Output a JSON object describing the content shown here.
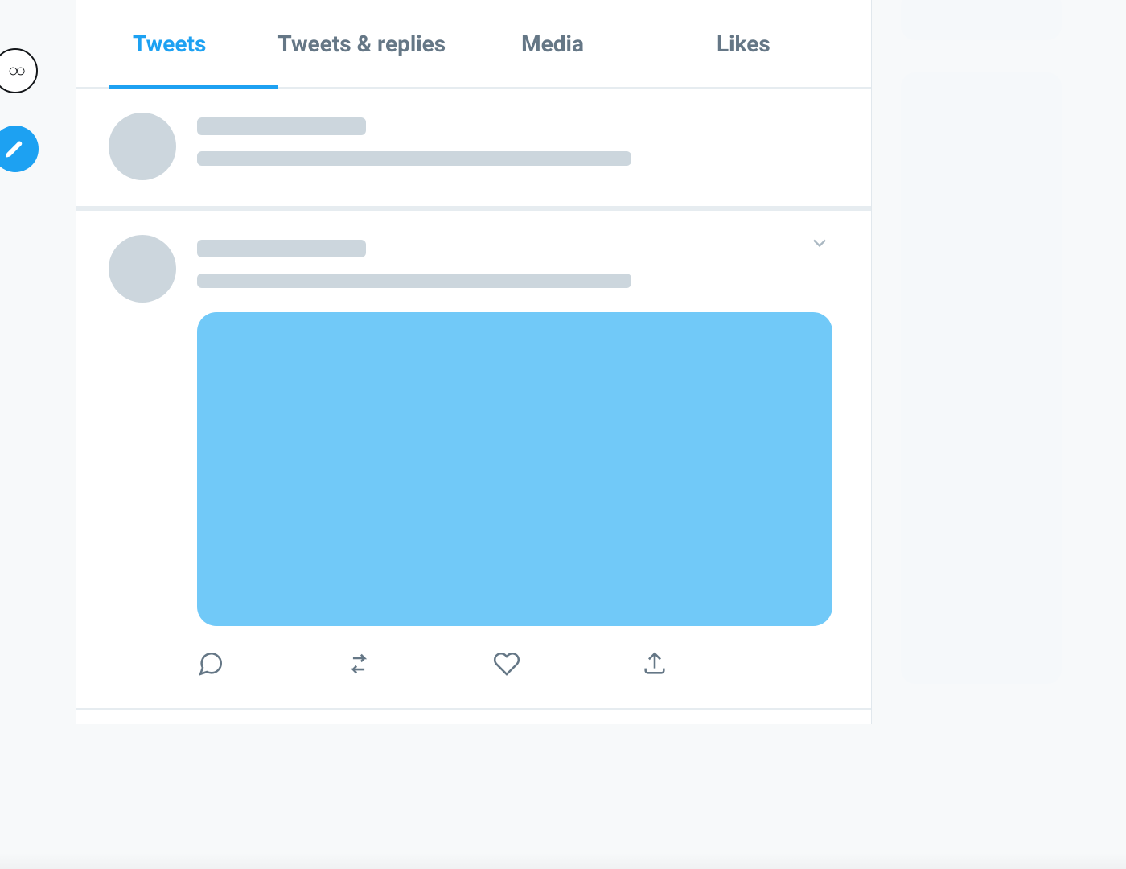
{
  "nav": {
    "more_label": "○○",
    "compose_label": "Compose"
  },
  "tabs": [
    {
      "label": "Tweets",
      "active": true
    },
    {
      "label": "Tweets & replies",
      "active": false
    },
    {
      "label": "Media",
      "active": false
    },
    {
      "label": "Likes",
      "active": false
    }
  ],
  "colors": {
    "brand": "#1da1f2",
    "skeleton": "#ccd6dd",
    "media_placeholder": "#71c9f8"
  },
  "icons": {
    "reply": "reply-icon",
    "retweet": "retweet-icon",
    "like": "like-icon",
    "share": "share-icon",
    "caret": "chevron-down-icon",
    "compose": "feather-icon",
    "more": "more-circle-icon"
  }
}
